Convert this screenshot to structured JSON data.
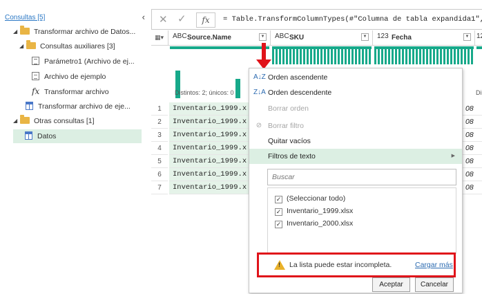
{
  "queries": {
    "header": "Consultas [5]",
    "collapse_glyph": "‹",
    "items": [
      {
        "label": "Transformar archivo de Datos...",
        "kind": "folder",
        "expanded": true
      },
      {
        "label": "Consultas auxiliares [3]",
        "kind": "folder",
        "expanded": true
      },
      {
        "label": "Parámetro1 (Archivo de ej...",
        "kind": "parameter"
      },
      {
        "label": "Archivo de ejemplo",
        "kind": "document"
      },
      {
        "label": "Transformar archivo",
        "kind": "function"
      },
      {
        "label": "Transformar archivo de eje...",
        "kind": "table"
      },
      {
        "label": "Otras consultas [1]",
        "kind": "folder",
        "expanded": true
      },
      {
        "label": "Datos",
        "kind": "table",
        "selected": true
      }
    ]
  },
  "formula_bar": {
    "cancel_glyph": "✕",
    "confirm_glyph": "✓",
    "fx_label": "fx",
    "formula": "= Table.TransformColumnTypes(#\"Columna de tabla expandida1\",{"
  },
  "grid": {
    "columns": [
      {
        "type": "ABC",
        "name": "Source.Name"
      },
      {
        "type": "ABC",
        "name": "SKU"
      },
      {
        "type": "123",
        "name": "Fecha"
      },
      {
        "type": "12",
        "name": ""
      }
    ],
    "profile": {
      "distinct_label": "Distintos: 2; únicos: 0",
      "next_partial": "Di"
    },
    "row_numbers": [
      "1",
      "2",
      "3",
      "4",
      "5",
      "6",
      "7"
    ],
    "source_name_cells": [
      "Inventario_1999.x",
      "Inventario_1999.x",
      "Inventario_1999.x",
      "Inventario_1999.x",
      "Inventario_1999.x",
      "Inventario_1999.x",
      "Inventario_1999.x"
    ],
    "fecha_partial_cells": [
      "08",
      "08",
      "08",
      "08",
      "08",
      "08",
      "08"
    ],
    "accent_color": "#17a98a"
  },
  "menu": {
    "items": [
      {
        "icon": "A↓Z",
        "label": "Orden ascendente",
        "disabled": false
      },
      {
        "icon": "Z↓A",
        "label": "Orden descendente",
        "disabled": false
      },
      {
        "icon": "",
        "label": "Borrar orden",
        "disabled": true
      },
      {
        "icon": "⊘",
        "label": "Borrar filtro",
        "disabled": true
      },
      {
        "icon": "",
        "label": "Quitar vacíos",
        "disabled": false
      },
      {
        "icon": "",
        "label": "Filtros de texto",
        "disabled": false,
        "submenu": true
      }
    ],
    "submenu_glyph": "▶",
    "search_placeholder": "Buscar",
    "filter_values": [
      {
        "label": "(Seleccionar todo)",
        "checked": true
      },
      {
        "label": "Inventario_1999.xlsx",
        "checked": true
      },
      {
        "label": "Inventario_2000.xlsx",
        "checked": true
      }
    ],
    "check_glyph": "✓",
    "notice": {
      "text": "La lista puede estar incompleta.",
      "link": "Cargar más",
      "highlight_color": "#e0131a"
    },
    "ok_button": "Aceptar",
    "cancel_button": "Cancelar"
  }
}
